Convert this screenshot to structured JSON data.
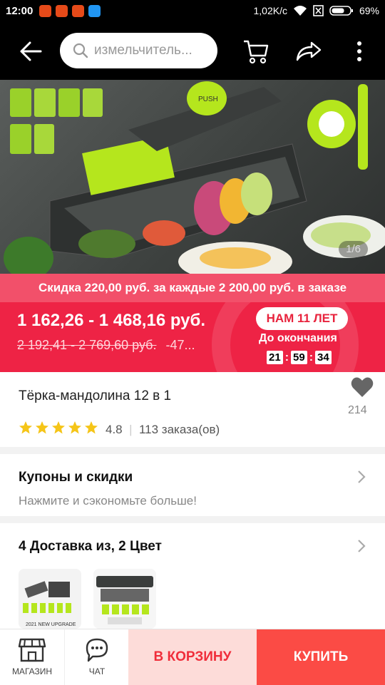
{
  "status_bar": {
    "time": "12:00",
    "network_speed": "1,02K/c",
    "battery": "69%"
  },
  "top_bar": {
    "search_text": "измельчитель..."
  },
  "hero": {
    "counter": "1/6",
    "push_label": "PUSH"
  },
  "promo": {
    "discount_text": "Скидка 220,00 руб. за каждые 2 200,00 руб. в заказе"
  },
  "price": {
    "current": "1 162,26 - 1 468,16 руб.",
    "old": "2 192,41 - 2 769,60 руб.",
    "discount": "-47...",
    "badge": "НАМ 11 ЛЕТ",
    "until_label": "До окончания",
    "timer": [
      "21",
      "59",
      "34"
    ]
  },
  "product": {
    "title": "Тёрка-мандолина 12 в 1",
    "rating": "4.8",
    "orders": "113 заказа(ов)",
    "likes": "214",
    "stars": 5
  },
  "coupons": {
    "title": "Купоны и скидки",
    "subtitle": "Нажмите и сэкономьте больше!"
  },
  "delivery": {
    "title": "4 Доставка из, 2 Цвет",
    "thumb_caption": "2021 NEW UPGRADE"
  },
  "bottom_bar": {
    "store_label": "МАГАЗИН",
    "chat_label": "ЧАТ",
    "cart_button": "В КОРЗИНУ",
    "buy_button": "КУПИТЬ"
  },
  "colors": {
    "accent_red": "#ee2345",
    "promo_pink": "#f2506a",
    "buy_red": "#fb4b45",
    "cart_pink": "#fddcd9",
    "star_yellow": "#f5c518",
    "lime": "#b5e61d"
  }
}
